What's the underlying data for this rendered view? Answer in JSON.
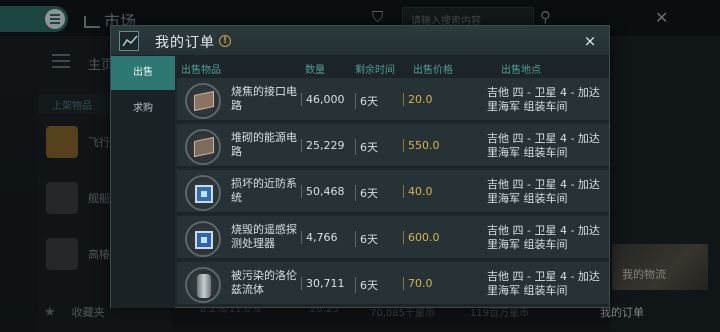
{
  "background": {
    "title": "市场",
    "search_placeholder": "请输入搜索内容",
    "home_label": "主页",
    "section_label": "上架物品",
    "rows": [
      {
        "label": "飞行"
      },
      {
        "label": "舰船"
      },
      {
        "label": "高椿"
      }
    ],
    "favorites_label": "收藏夹",
    "logistics_label": "我的物流",
    "my_orders_label": "我的订单",
    "bottom_bar": [
      "8.2%/11.0%",
      "20.25",
      "70,085千星币",
      "119百万星币"
    ]
  },
  "modal": {
    "title": "我的订单",
    "info_icon": "!",
    "close_icon": "×",
    "tabs": [
      {
        "label": "出售",
        "active": true
      },
      {
        "label": "求购",
        "active": false
      }
    ],
    "columns": {
      "item": "出售物品",
      "qty": "数量",
      "time": "剩余时间",
      "price": "出售价格",
      "location": "出售地点"
    },
    "orders": [
      {
        "name": "烧焦的接口电路",
        "qty": "46,000",
        "time": "6天",
        "price": "20.0",
        "location": "吉他 四 - 卫星 4 - 加达里海军 组装车间",
        "icon": "burnt-circuit-icon"
      },
      {
        "name": "堆砌的能源电路",
        "qty": "25,229",
        "time": "6天",
        "price": "550.0",
        "location": "吉他 四 - 卫星 4 - 加达里海军 组装车间",
        "icon": "power-circuit-icon"
      },
      {
        "name": "损坏的近防系统",
        "qty": "50,468",
        "time": "6天",
        "price": "40.0",
        "location": "吉他 四 - 卫星 4 - 加达里海军 组装车间",
        "icon": "defense-system-icon"
      },
      {
        "name": "烧毁的遥感探测处理器",
        "qty": "4,766",
        "time": "6天",
        "price": "600.0",
        "location": "吉他 四 - 卫星 4 - 加达里海军 组装车间",
        "icon": "sensor-processor-icon"
      },
      {
        "name": "被污染的洛伦兹流体",
        "qty": "30,711",
        "time": "6天",
        "price": "70.0",
        "location": "吉他 四 - 卫星 4 - 加达里海军 组装车间",
        "icon": "lorentz-fluid-icon"
      }
    ]
  }
}
